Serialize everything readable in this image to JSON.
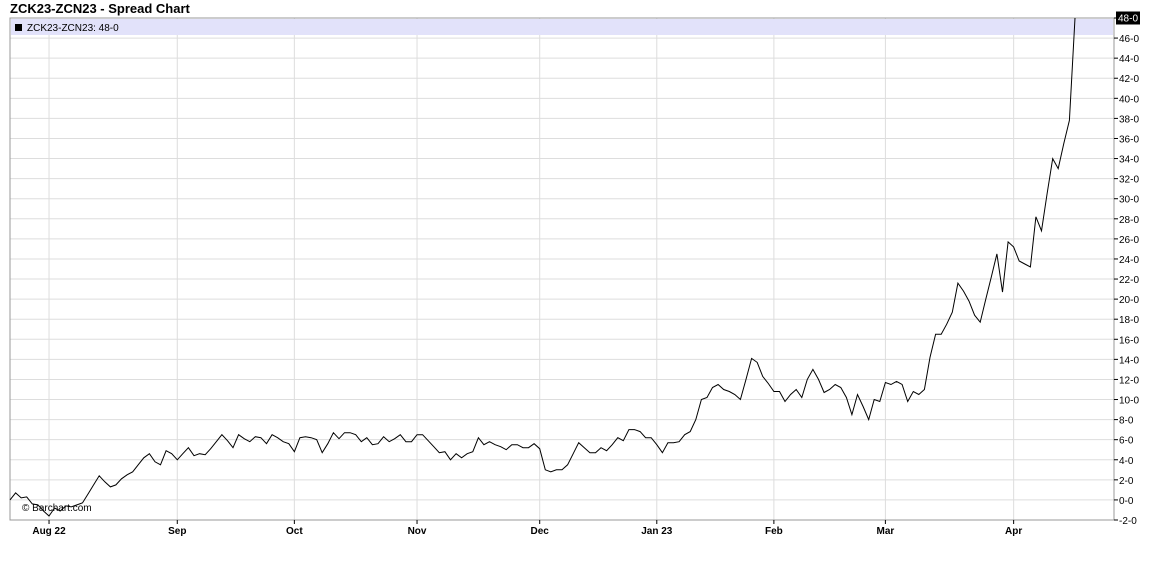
{
  "chart_data": {
    "type": "line",
    "title": "ZCK23-ZCN23 - Spread Chart",
    "legend": {
      "label": "ZCK23-ZCN23: 48-0",
      "position": "top-left"
    },
    "last_value_label": "48-0",
    "credit": "© Barchart.com",
    "ylim": [
      -2,
      48
    ],
    "y_ticks": [
      "-2-0",
      "0-0",
      "2-0",
      "4-0",
      "6-0",
      "8-0",
      "10-0",
      "12-0",
      "14-0",
      "16-0",
      "18-0",
      "20-0",
      "22-0",
      "24-0",
      "26-0",
      "28-0",
      "30-0",
      "32-0",
      "34-0",
      "36-0",
      "38-0",
      "40-0",
      "42-0",
      "44-0",
      "46-0",
      "48-0"
    ],
    "y_tick_values": [
      -2,
      0,
      2,
      4,
      6,
      8,
      10,
      12,
      14,
      16,
      18,
      20,
      22,
      24,
      26,
      28,
      30,
      32,
      34,
      36,
      38,
      40,
      42,
      44,
      46,
      48
    ],
    "x_ticks": [
      {
        "label": "Aug 22",
        "index": 7
      },
      {
        "label": "Sep",
        "index": 30
      },
      {
        "label": "Oct",
        "index": 51
      },
      {
        "label": "Nov",
        "index": 73
      },
      {
        "label": "Dec",
        "index": 95
      },
      {
        "label": "Jan 23",
        "index": 116
      },
      {
        "label": "Feb",
        "index": 137
      },
      {
        "label": "Mar",
        "index": 157
      },
      {
        "label": "Apr",
        "index": 180
      }
    ],
    "x_range": [
      0,
      198
    ],
    "grid": true,
    "series": [
      {
        "values": [
          0,
          0.7,
          0.2,
          0.3,
          -0.4,
          -0.5,
          -1.1,
          -1.6,
          -0.8,
          -1.1,
          -0.6,
          -0.7,
          -0.5,
          -0.3,
          0.6,
          1.5,
          2.4,
          1.8,
          1.3,
          1.5,
          2.1,
          2.5,
          2.8,
          3.5,
          4.2,
          4.6,
          3.8,
          3.5,
          4.9,
          4.6,
          4.0,
          4.6,
          5.2,
          4.4,
          4.6,
          4.5,
          5.1,
          5.8,
          6.5,
          5.9,
          5.2,
          6.5,
          6.1,
          5.8,
          6.3,
          6.2,
          5.6,
          6.5,
          6.2,
          5.8,
          5.6,
          4.8,
          6.2,
          6.3,
          6.2,
          6.0,
          4.7,
          5.6,
          6.7,
          6.1,
          6.7,
          6.7,
          6.5,
          5.8,
          6.2,
          5.5,
          5.6,
          6.3,
          5.8,
          6.1,
          6.5,
          5.8,
          5.8,
          6.5,
          6.5,
          5.9,
          5.3,
          4.7,
          4.8,
          4.0,
          4.6,
          4.2,
          4.6,
          4.8,
          6.2,
          5.5,
          5.8,
          5.5,
          5.3,
          5.0,
          5.5,
          5.5,
          5.2,
          5.2,
          5.6,
          5.1,
          3.0,
          2.8,
          3.0,
          3.0,
          3.5,
          4.6,
          5.7,
          5.2,
          4.7,
          4.7,
          5.2,
          4.9,
          5.5,
          6.2,
          5.9,
          7.0,
          7.0,
          6.8,
          6.2,
          6.2,
          5.5,
          4.7,
          5.7,
          5.7,
          5.8,
          6.5,
          6.8,
          8.0,
          10.0,
          10.2,
          11.2,
          11.5,
          11.0,
          10.8,
          10.5,
          10.0,
          12.0,
          14.1,
          13.7,
          12.3,
          11.6,
          10.8,
          10.8,
          9.8,
          10.5,
          11.0,
          10.2,
          12.0,
          13.0,
          12.0,
          10.7,
          11.0,
          11.5,
          11.2,
          10.2,
          8.5,
          10.5,
          9.3,
          8.0,
          10.0,
          9.8,
          11.7,
          11.5,
          11.8,
          11.5,
          9.8,
          10.8,
          10.5,
          11.0,
          14.2,
          16.5,
          16.5,
          17.5,
          18.7,
          21.6,
          20.8,
          19.8,
          18.4,
          17.7,
          20.0,
          22.2,
          24.5,
          20.7,
          25.7,
          25.2,
          23.8,
          23.5,
          23.2,
          28.2,
          26.8,
          30.5,
          34.0,
          33.0,
          35.5,
          37.8,
          48.0
        ]
      }
    ]
  }
}
